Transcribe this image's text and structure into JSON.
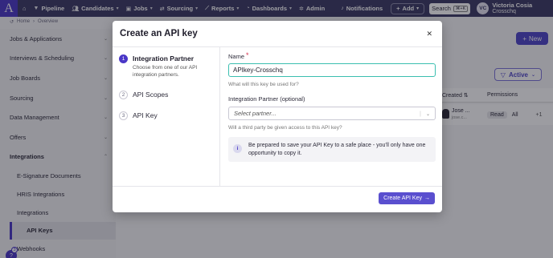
{
  "nav": {
    "logo": "A",
    "items": [
      {
        "label": "Pipeline",
        "icon": "filter-icon"
      },
      {
        "label": "Candidates",
        "icon": "people-icon"
      },
      {
        "label": "Jobs",
        "icon": "briefcase-icon"
      },
      {
        "label": "Sourcing",
        "icon": "sourcing-icon"
      },
      {
        "label": "Reports",
        "icon": "chart-icon"
      },
      {
        "label": "Dashboards",
        "icon": "gauge-icon"
      },
      {
        "label": "Admin",
        "icon": "gear-icon"
      },
      {
        "label": "Notifications",
        "icon": "bell-icon"
      }
    ],
    "add_label": "Add",
    "search_label": "Search",
    "search_shortcut": "⌘+K",
    "user": {
      "initials": "VC",
      "name": "Victoria Cosia",
      "org": "Crosschq"
    }
  },
  "breadcrumb": {
    "home": "Home",
    "current": "Overview"
  },
  "sidebar": {
    "sections": [
      "Jobs & Applications",
      "Interviews & Scheduling",
      "Job Boards",
      "Sourcing",
      "Data Management",
      "Offers",
      "Integrations"
    ],
    "sub_items": [
      "E-Signature Documents",
      "HRIS Integrations",
      "Integrations",
      "API Keys",
      "Webhooks"
    ],
    "help_count": "3"
  },
  "background": {
    "new_label": "New",
    "filter_label": "Active",
    "columns": [
      "Created",
      "Permissions"
    ],
    "row": {
      "name": "Jose ...",
      "sub": "jose.c...",
      "perm_read": "Read",
      "perm_all": "All",
      "more": "+1"
    }
  },
  "modal": {
    "title": "Create an API key",
    "steps": [
      {
        "num": "1",
        "title": "Integration Partner",
        "desc": "Choose from one of our API integration partners."
      },
      {
        "num": "2",
        "title": "API Scopes"
      },
      {
        "num": "3",
        "title": "API Key"
      }
    ],
    "name_label": "Name",
    "name_value": "APIkey-Crosschq",
    "name_help": "What will this key be used for?",
    "partner_label": "Integration Partner (optional)",
    "partner_placeholder": "Select partner...",
    "partner_help": "Will a third party be given access to this API key?",
    "info_icon": "i",
    "info_text": "Be prepared to save your API Key to a safe place - you'll only have one opportunity to copy it.",
    "submit_label": "Create API Key"
  }
}
